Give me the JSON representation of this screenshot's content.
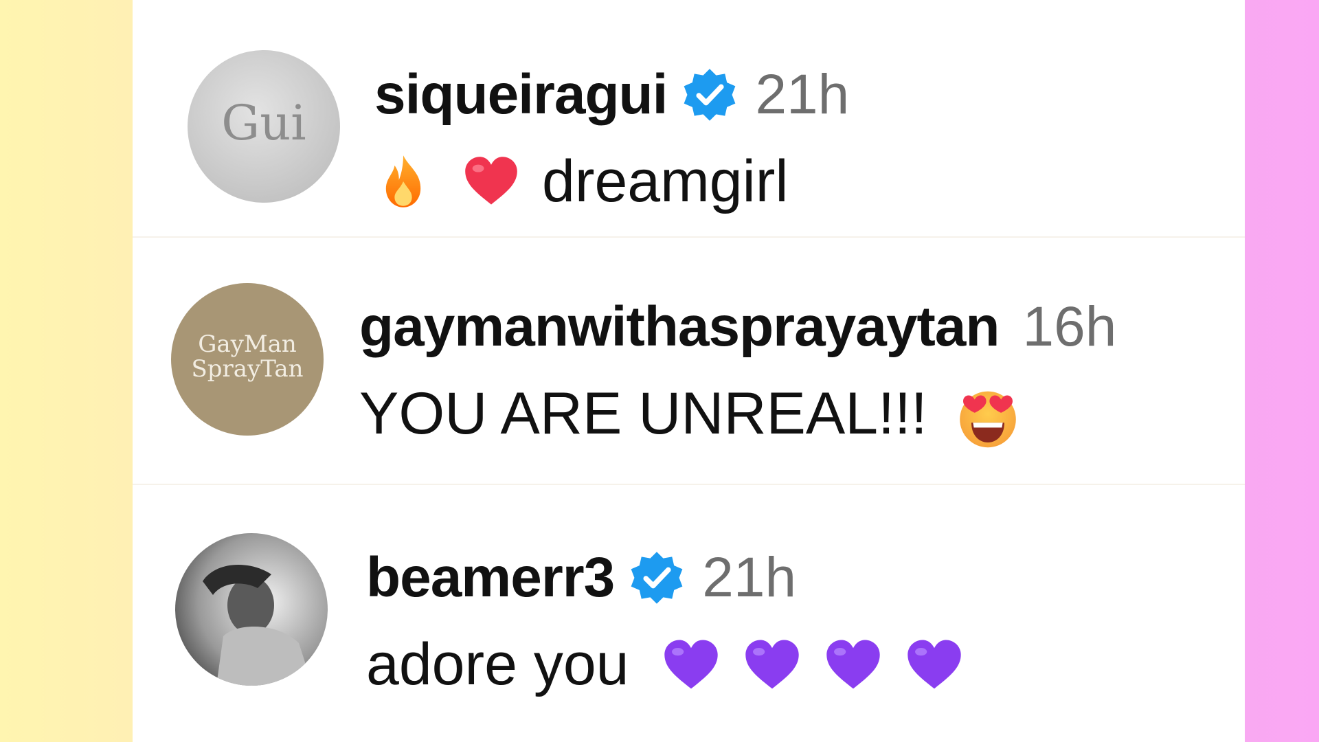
{
  "comments": [
    {
      "username": "siqueiragui",
      "verified": true,
      "time": "21h",
      "text": "dreamgirl",
      "emojis_before": [
        "fire-emoji",
        "red-heart-emoji"
      ],
      "avatar_text": "Gui"
    },
    {
      "username": "gaymanwithasprayaytan",
      "verified": false,
      "time": "16h",
      "text": "YOU ARE UNREAL!!!",
      "emojis_after": [
        "star-struck-emoji"
      ],
      "avatar_text_line1": "GayMan",
      "avatar_text_line2": "SprayTan"
    },
    {
      "username": "beamerr3",
      "verified": true,
      "time": "21h",
      "text": "adore you",
      "emojis_after": [
        "purple-heart-emoji",
        "purple-heart-emoji",
        "purple-heart-emoji",
        "purple-heart-emoji"
      ]
    }
  ],
  "colors": {
    "left_background": "#fff0b4",
    "right_background": "#faa7f4",
    "verified_blue": "#1d9bf0",
    "time_gray": "#6e6e6e",
    "purple_heart": "#8a3df0"
  }
}
